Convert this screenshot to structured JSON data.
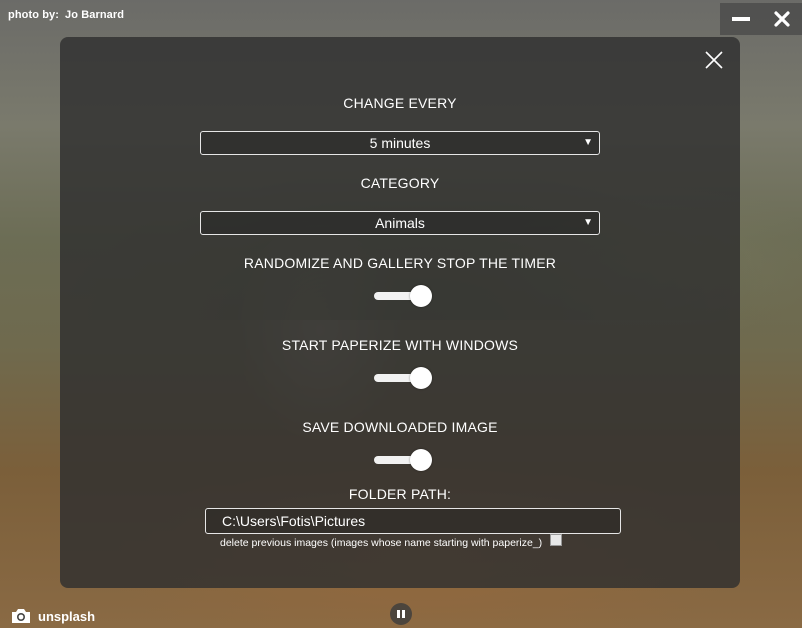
{
  "credit": {
    "prefix": "photo by:",
    "author": "Jo Barnard"
  },
  "window_controls": {
    "minimize_icon": "minimize-icon",
    "close_icon": "close-icon"
  },
  "settings": {
    "change_every_label": "CHANGE EVERY",
    "change_every_value": "5 minutes",
    "category_label": "CATEGORY",
    "category_value": "Animals",
    "randomize_label": "RANDOMIZE AND GALLERY STOP THE TIMER",
    "randomize_on": true,
    "start_with_windows_label": "START PAPERIZE WITH WINDOWS",
    "start_with_windows_on": true,
    "save_downloaded_label": "SAVE DOWNLOADED IMAGE",
    "save_downloaded_on": true,
    "folder_path_label": "FOLDER PATH:",
    "folder_path_value": "C:\\Users\\Fotis\\Pictures",
    "delete_previous_label": "delete previous images (images whose name starting with paperize_)",
    "delete_previous_checked": false
  },
  "footer": {
    "source_label": "unsplash"
  }
}
